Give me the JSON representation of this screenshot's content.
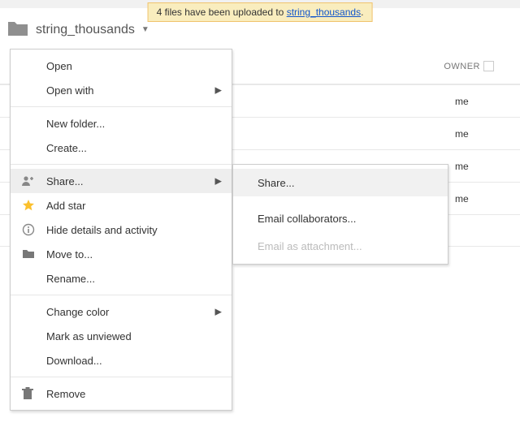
{
  "notification": {
    "prefix": "4 files have been uploaded to ",
    "link_text": "string_thousands",
    "suffix": "."
  },
  "breadcrumb": {
    "folder_name": "string_thousands"
  },
  "table": {
    "owner_header": "OWNER",
    "rows": [
      {
        "owner": "me"
      },
      {
        "owner": "me"
      },
      {
        "owner": "me"
      },
      {
        "owner": "me"
      }
    ]
  },
  "menu": {
    "open": "Open",
    "open_with": "Open with",
    "new_folder": "New folder...",
    "create": "Create...",
    "share": "Share...",
    "add_star": "Add star",
    "hide_details": "Hide details and activity",
    "move_to": "Move to...",
    "rename": "Rename...",
    "change_color": "Change color",
    "mark_unviewed": "Mark as unviewed",
    "download": "Download...",
    "remove": "Remove"
  },
  "submenu": {
    "share": "Share...",
    "email_collab": "Email collaborators...",
    "email_attach": "Email as attachment..."
  }
}
